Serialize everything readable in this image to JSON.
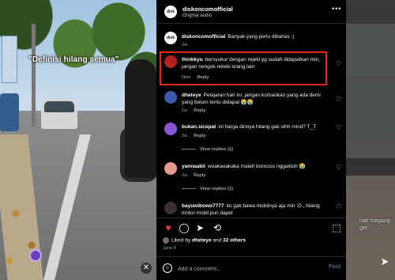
{
  "video": {
    "overlay_caption": "\"Definisi hilang semua\"",
    "right_partial_text": "hak magang\nger..."
  },
  "header": {
    "username": "diskoncomofficial",
    "subtitle": "Original audio",
    "avatar_text": "disk"
  },
  "caption_comment": {
    "username": "diskoncomofficial",
    "text": "Banyak yang perlu dibahas :)",
    "time": "2w",
    "avatar_text": "disk"
  },
  "comments": [
    {
      "username": "thinkkyu",
      "text": "bersyukur dengan rejeki yg sudah didapatkan min, jangan nengok rekeki orang lain",
      "time": "Now",
      "reply_label": "Reply",
      "highlighted": true,
      "avatar_color": "#b3221b"
    },
    {
      "username": "dheteye",
      "text": "Pelajaran hari ini: jangan korbankan yang ada demi yang belum tentu didapat 😭😭",
      "time": "1w",
      "reply_label": "Reply",
      "avatar_color": "#3b5ba9"
    },
    {
      "username": "bukan.sicepat",
      "text": "ini harga dirinya hilang gak sihh mind? T_T",
      "time": "2w",
      "reply_label": "Reply",
      "view_replies": "View replies (1)",
      "avatar_color": "#8b56d6"
    },
    {
      "username": "yannaabii",
      "text": "woakaoakaka malah boncoss nggaktuh 😭",
      "time": "2w",
      "reply_label": "Reply",
      "view_replies": "View replies (1)",
      "avatar_color": "#e59a8b"
    },
    {
      "username": "bayuwibowo7777",
      "text": "itu gak bawa mobilnya aja min :D , hilang motor mobil pun dapet",
      "time": "",
      "reply_label": "",
      "avatar_color": "#3a3030"
    }
  ],
  "actions": {
    "liked_prefix": "Liked by",
    "liked_user": "dheteye",
    "liked_and": "and",
    "liked_count": "32 others",
    "date": "June 4"
  },
  "add_comment": {
    "placeholder": "Add a comment...",
    "post_label": "Post"
  },
  "icons": {
    "like": "heart-filled-icon",
    "comment": "comment-icon",
    "share": "share-icon",
    "save": "bookmark-icon",
    "mute": "speaker-muted-icon",
    "emoji": "emoji-icon"
  },
  "colors": {
    "highlight_border": "#e1281e",
    "like_red": "#ff3040",
    "panel_bg": "#000000"
  }
}
